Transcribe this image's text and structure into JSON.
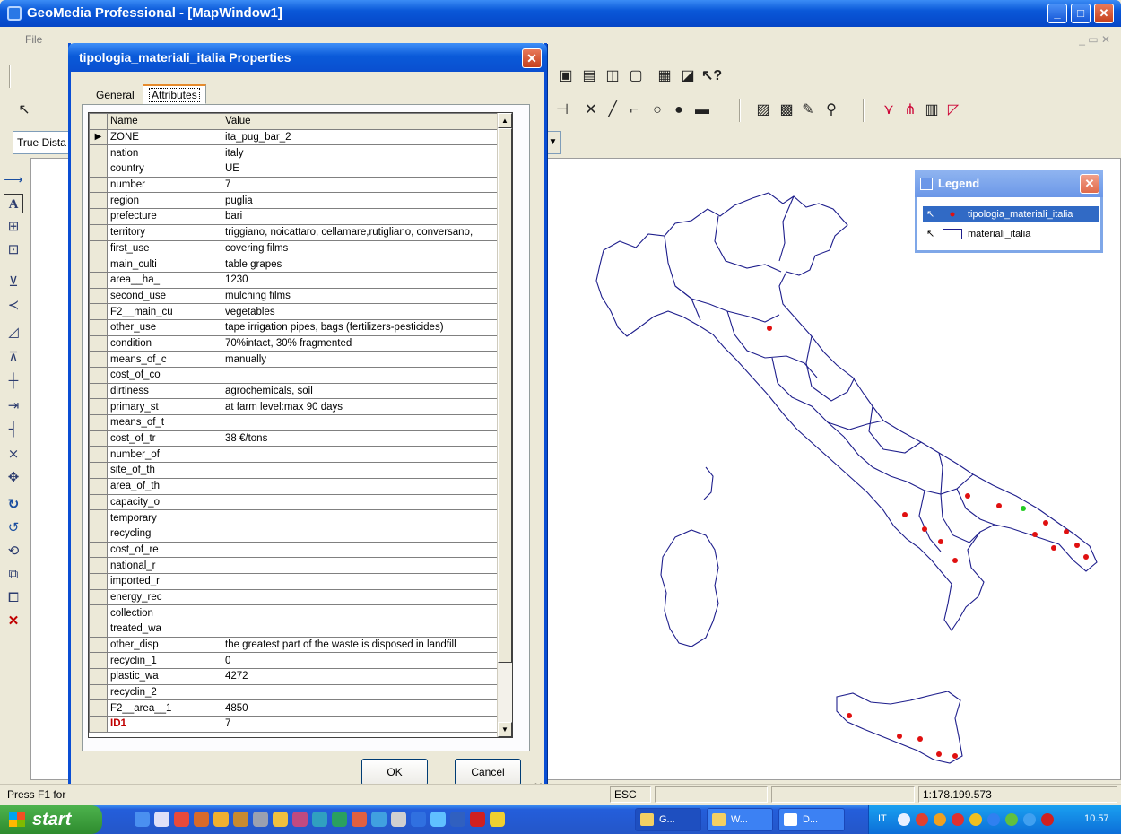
{
  "app": {
    "title": "GeoMedia Professional - [MapWindow1]",
    "menu_label": "File"
  },
  "toolbar": {
    "measure_mode": "True Dista"
  },
  "dialog": {
    "title": "tipologia_materiali_italia Properties",
    "tabs": [
      "General",
      "Attributes"
    ],
    "active_tab": "Attributes",
    "grid_headers": {
      "name": "Name",
      "value": "Value"
    },
    "rows": [
      {
        "name": "ZONE",
        "value": "ita_pug_bar_2"
      },
      {
        "name": "nation",
        "value": "italy"
      },
      {
        "name": "country",
        "value": "UE"
      },
      {
        "name": "number",
        "value": "7"
      },
      {
        "name": "region",
        "value": "puglia"
      },
      {
        "name": "prefecture",
        "value": "bari"
      },
      {
        "name": "territory",
        "value": "triggiano, noicattaro, cellamare,rutigliano, conversano,"
      },
      {
        "name": "first_use",
        "value": "covering films"
      },
      {
        "name": "main_culti",
        "value": "table grapes"
      },
      {
        "name": "area__ha_",
        "value": "1230"
      },
      {
        "name": "second_use",
        "value": "mulching films"
      },
      {
        "name": "F2__main_cu",
        "value": "vegetables"
      },
      {
        "name": "other_use",
        "value": "tape irrigation pipes, bags (fertilizers-pesticides)"
      },
      {
        "name": "condition",
        "value": "70%intact, 30% fragmented"
      },
      {
        "name": "means_of_c",
        "value": "manually"
      },
      {
        "name": "cost_of_co",
        "value": ""
      },
      {
        "name": "dirtiness",
        "value": "agrochemicals, soil"
      },
      {
        "name": "primary_st",
        "value": "at farm level:max 90 days"
      },
      {
        "name": "means_of_t",
        "value": ""
      },
      {
        "name": "cost_of_tr",
        "value": "38 €/tons"
      },
      {
        "name": "number_of",
        "value": ""
      },
      {
        "name": "site_of_th",
        "value": ""
      },
      {
        "name": "area_of_th",
        "value": ""
      },
      {
        "name": "capacity_o",
        "value": ""
      },
      {
        "name": "temporary",
        "value": ""
      },
      {
        "name": "recycling",
        "value": ""
      },
      {
        "name": "cost_of_re",
        "value": ""
      },
      {
        "name": "national_r",
        "value": ""
      },
      {
        "name": "imported_r",
        "value": ""
      },
      {
        "name": "energy_rec",
        "value": ""
      },
      {
        "name": "collection",
        "value": ""
      },
      {
        "name": "treated_wa",
        "value": ""
      },
      {
        "name": "other_disp",
        "value": "the greatest part of the waste is disposed in landfill"
      },
      {
        "name": "recyclin_1",
        "value": "0"
      },
      {
        "name": "plastic_wa",
        "value": "4272"
      },
      {
        "name": "recyclin_2",
        "value": ""
      },
      {
        "name": "F2__area__1",
        "value": "4850"
      },
      {
        "name": "ID1",
        "value": "7"
      }
    ],
    "ok_label": "OK",
    "cancel_label": "Cancel"
  },
  "legend": {
    "title": "Legend",
    "entries": [
      {
        "label": "tipologia_materiali_italia",
        "selected": true,
        "color": "#e01010"
      },
      {
        "label": "materiali_italia",
        "selected": false,
        "color": "#1e1e8c"
      }
    ]
  },
  "status": {
    "help": "Press F1 for",
    "esc": "ESC",
    "scale": "1:178.199.573"
  },
  "taskbar": {
    "start_label": "start",
    "tasks": [
      "G...",
      "W...",
      "D..."
    ],
    "tray_lang": "IT",
    "clock": "10.57"
  },
  "map_points": {
    "red": [
      [
        857,
        365
      ],
      [
        1078,
        552
      ],
      [
        1113,
        563
      ],
      [
        1008,
        573
      ],
      [
        1030,
        589
      ],
      [
        1048,
        603
      ],
      [
        1064,
        624
      ],
      [
        1165,
        582
      ],
      [
        1153,
        595
      ],
      [
        1174,
        610
      ],
      [
        1188,
        592
      ],
      [
        1200,
        607
      ],
      [
        1210,
        620
      ],
      [
        946,
        797
      ],
      [
        1002,
        820
      ],
      [
        1025,
        823
      ],
      [
        1046,
        840
      ],
      [
        1064,
        842
      ]
    ],
    "green": [
      [
        1140,
        566
      ]
    ]
  },
  "colors": {
    "accent": "#0a4ed4",
    "boundary": "#1e1e8c",
    "point_red": "#e01010",
    "point_green": "#22cc22"
  }
}
